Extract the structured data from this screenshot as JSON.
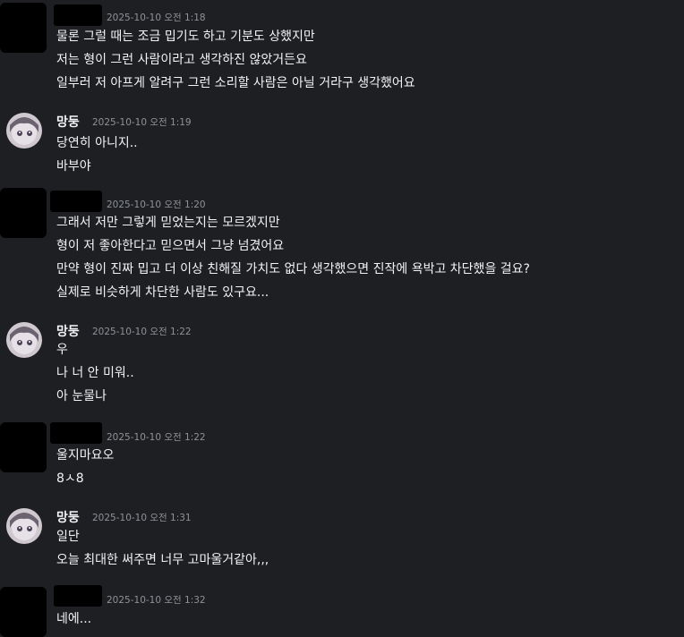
{
  "messages": [
    {
      "author": "",
      "timestamp": "2025-10-10 오전 1:18",
      "lines": [
        "물론 그럴 때는 조금 밉기도 하고 기분도 상했지만",
        "저는 형이 그런 사람이라고 생각하진 않았거든요",
        "일부러 저 아프게 알려구 그런 소리할 사람은 아닐 거라구 생각했어요"
      ]
    },
    {
      "author": "망둥",
      "timestamp": "2025-10-10 오전 1:19",
      "lines": [
        "당연히 아니지..",
        "바부야"
      ]
    },
    {
      "author": "",
      "timestamp": "2025-10-10 오전 1:20",
      "lines": [
        "그래서 저만 그렇게 믿었는지는 모르겠지만",
        "형이 저 좋아한다고 믿으면서 그냥 넘겼어요",
        "만약 형이 진짜 밉고 더 이상 친해질 가치도 없다 생각했으면 진작에 욕박고 차단했을 걸요?",
        "실제로 비슷하게 차단한 사람도 있구요..."
      ]
    },
    {
      "author": "망둥",
      "timestamp": "2025-10-10 오전 1:22",
      "lines": [
        "우",
        "나 너 안 미워..",
        "아 눈물나"
      ]
    },
    {
      "author": "",
      "timestamp": "2025-10-10 오전 1:22",
      "lines": [
        "울지마요오",
        "8ㅅ8"
      ]
    },
    {
      "author": "망둥",
      "timestamp": "2025-10-10 오전 1:31",
      "lines": [
        "일단",
        "오늘 최대한 써주면 너무 고마울거같아,,,"
      ]
    },
    {
      "author": "",
      "timestamp": "2025-10-10 오전 1:32",
      "lines": [
        "네에..."
      ]
    }
  ],
  "colors": {
    "background": "#1e1f22",
    "text": "#f2f3f5",
    "timestamp": "#8e9297"
  }
}
